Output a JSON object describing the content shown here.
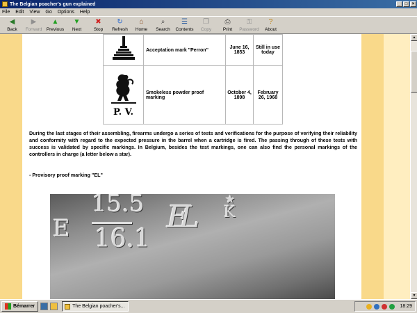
{
  "window": {
    "title": "The Belgian poacher's gun explained"
  },
  "menu": [
    "File",
    "Edit",
    "View",
    "Go",
    "Options",
    "Help"
  ],
  "toolbar": [
    {
      "label": "Back",
      "icon": "back-arrow-icon",
      "glyph": "◀",
      "color": "#2a7a2a",
      "enabled": true
    },
    {
      "label": "Forward",
      "icon": "forward-arrow-icon",
      "glyph": "▶",
      "color": "#909090",
      "enabled": false
    },
    {
      "label": "Previous",
      "icon": "previous-up-arrow-icon",
      "glyph": "▲",
      "color": "#1fa01f",
      "enabled": true
    },
    {
      "label": "Next",
      "icon": "next-down-arrow-icon",
      "glyph": "▼",
      "color": "#1fa01f",
      "enabled": true
    },
    {
      "label": "Stop",
      "icon": "stop-icon",
      "glyph": "✖",
      "color": "#d02020",
      "enabled": true
    },
    {
      "label": "Refresh",
      "icon": "refresh-icon",
      "glyph": "↻",
      "color": "#2a6ad0",
      "enabled": true
    },
    {
      "label": "Home",
      "icon": "home-icon",
      "glyph": "⌂",
      "color": "#8a4a1a",
      "enabled": true
    },
    {
      "label": "Search",
      "icon": "search-icon",
      "glyph": "⌕",
      "color": "#404040",
      "enabled": true
    },
    {
      "label": "Contents",
      "icon": "contents-icon",
      "glyph": "☰",
      "color": "#3060a0",
      "enabled": true
    },
    {
      "label": "Copy",
      "icon": "copy-icon",
      "glyph": "❐",
      "color": "#909090",
      "enabled": false
    },
    {
      "label": "Print",
      "icon": "print-icon",
      "glyph": "⎙",
      "color": "#404040",
      "enabled": true
    },
    {
      "label": "Password",
      "icon": "password-icon",
      "glyph": "⚿",
      "color": "#909090",
      "enabled": false
    },
    {
      "label": "About",
      "icon": "about-icon",
      "glyph": "?",
      "color": "#c08010",
      "enabled": true
    }
  ],
  "table": {
    "rows": [
      {
        "name": "Acceptation mark \"Perron\"",
        "date1": "June 16, 1853",
        "date2": "Still in use today",
        "mark": "perron"
      },
      {
        "name": "Smokeless powder proof marking",
        "date1": "October 4, 1898",
        "date2": "February 26, 1968",
        "mark": "lion",
        "mark_text": "P. V."
      }
    ]
  },
  "body": {
    "paragraph": "During the last stages of their assembling, firearms undergo a series of tests and verifications for the purpose of verifying their reliability and conformity with regard to the expected pressure in the barrel when a cartridge is fired. The passing through of these tests with success is validated by specific markings. In Belgium, besides the test markings, one can also find the personal markings of the controllers in charge (a letter below a star).",
    "subheading": "- Provisory proof marking \"EL\""
  },
  "photo": {
    "letter_left": "E",
    "fraction_top": "15.5",
    "fraction_bottom": "16.1",
    "monogram": "EL",
    "controller_letter": "K"
  },
  "taskbar": {
    "start_label": "Bémarrer",
    "task_label": "The Belgian poacher's...",
    "clock": "18:29"
  }
}
